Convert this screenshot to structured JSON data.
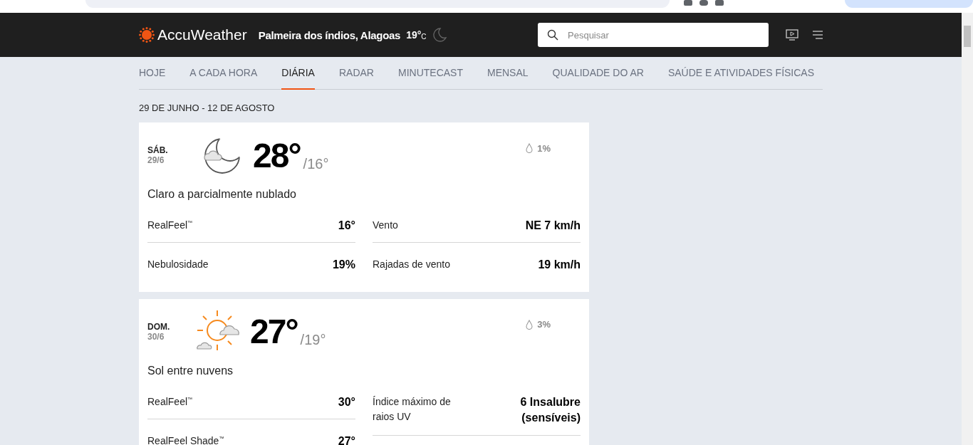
{
  "header": {
    "logo": "AccuWeather",
    "location": "Palmeira dos índios, Alagoas",
    "current_temp": "19°",
    "unit": "C",
    "search": {
      "placeholder": "Pesquisar"
    }
  },
  "tabs": [
    {
      "label": "HOJE",
      "selected": false
    },
    {
      "label": "A CADA HORA",
      "selected": false
    },
    {
      "label": "DIÁRIA",
      "selected": true
    },
    {
      "label": "RADAR",
      "selected": false
    },
    {
      "label": "MINUTECAST",
      "selected": false
    },
    {
      "label": "MENSAL",
      "selected": false
    },
    {
      "label": "QUALIDADE DO AR",
      "selected": false
    },
    {
      "label": "SAÚDE E ATIVIDADES FÍSICAS",
      "selected": false
    }
  ],
  "date_range": "29 DE JUNHO - 12 DE AGOSTO",
  "days": [
    {
      "day": "SÁB.",
      "date": "29/6",
      "kind": "night",
      "high": "28°",
      "low": "/16°",
      "precip": "1%",
      "phrase": "Claro a parcialmente nublado",
      "columns": [
        {
          "rows": [
            {
              "label": "RealFeel$^{™}$",
              "value": "16°"
            },
            {
              "label": "Nebulosidade",
              "value": "19%"
            }
          ]
        },
        {
          "rows": [
            {
              "label": "Vento",
              "value": "NE 7 km/h"
            },
            {
              "label": "Rajadas de vento",
              "value": "19 km/h"
            }
          ]
        }
      ]
    },
    {
      "day": "DOM.",
      "date": "30/6",
      "kind": "sun",
      "high": "27°",
      "low": "/19°",
      "precip": "3%",
      "phrase": "Sol entre nuvens",
      "columns": [
        {
          "rows": [
            {
              "label": "RealFeel$^{™}$",
              "value": "30°"
            },
            {
              "label": "RealFeel Shade$^{™}$",
              "value": "27°"
            }
          ]
        },
        {
          "rows": [
            {
              "label": "Índice máximo de raios UV",
              "value": "6 Insalubre (sensíveis)"
            }
          ]
        }
      ]
    }
  ]
}
